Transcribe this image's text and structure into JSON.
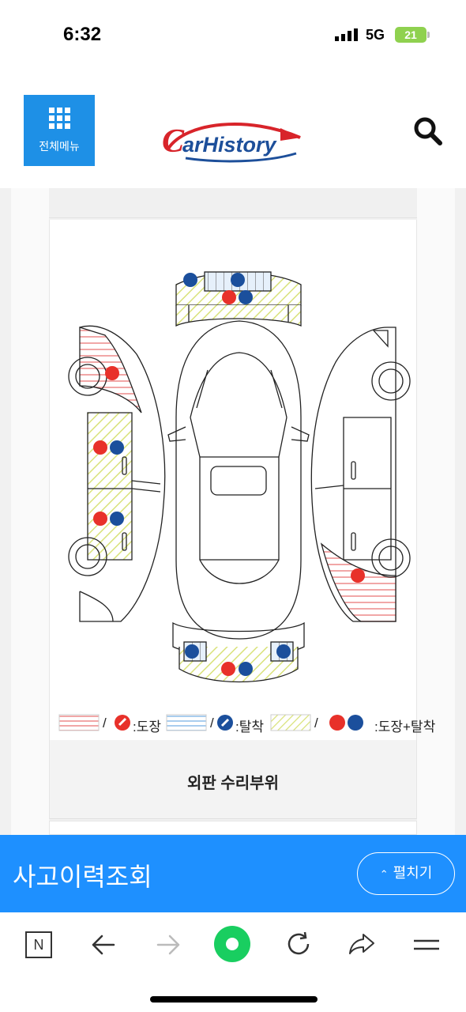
{
  "status_bar": {
    "time": "6:32",
    "network": "5G",
    "battery": "21"
  },
  "header": {
    "menu_label": "전체메뉴",
    "logo_text": "CarHistory",
    "icons": [
      "menu-grid-icon",
      "search-icon"
    ]
  },
  "diagram": {
    "legend": {
      "paint": ":도장",
      "detach": ":탈착",
      "both": ":도장+탈착",
      "separator": "/"
    },
    "colors": {
      "paint": "#e8312a",
      "detach": "#1b4f9c",
      "paint_stripe": "#f1a7a7",
      "detach_stripe": "#a9cdee",
      "both_stripe": "#d9e27a"
    }
  },
  "section": {
    "title": "외판 수리부위"
  },
  "bottom_bar": {
    "title": "사고이력조회",
    "expand_label": "펼치기"
  },
  "browser_nav": {
    "n_label": "N",
    "icons": [
      "naver-n-icon",
      "back-arrow-icon",
      "forward-arrow-icon",
      "naver-green-dot-icon",
      "reload-icon",
      "share-icon",
      "menu-icon"
    ]
  }
}
